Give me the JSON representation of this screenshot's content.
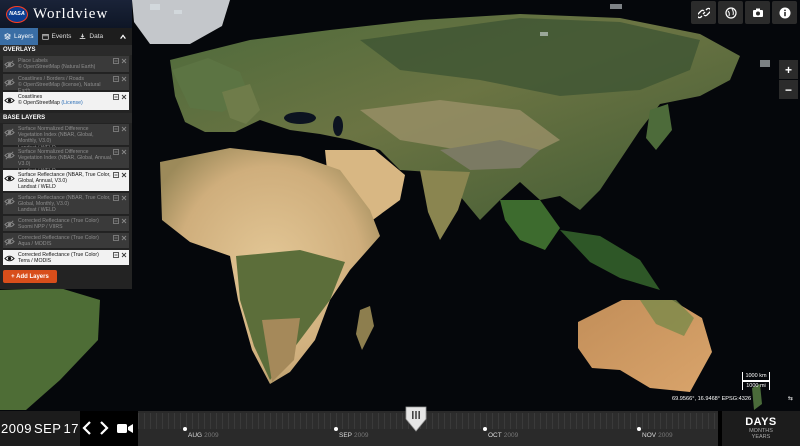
{
  "app": {
    "logo_text": "NASA",
    "title": "Worldview"
  },
  "tabs": [
    {
      "label": "Layers",
      "icon": "layers-icon",
      "active": true
    },
    {
      "label": "Events",
      "icon": "calendar-icon",
      "active": false
    },
    {
      "label": "Data",
      "icon": "download-icon",
      "active": false
    }
  ],
  "overlays": {
    "title": "OVERLAYS",
    "layers": [
      {
        "name": "Place Labels",
        "source": "© OpenStreetMap (Natural Earth)",
        "license": "",
        "visible": false
      },
      {
        "name": "Coastlines / Borders / Roads",
        "source": "© OpenStreetMap (license), Natural Earth",
        "license": "",
        "visible": false
      },
      {
        "name": "Coastlines",
        "source": "© OpenStreetMap",
        "license": "(License)",
        "visible": true
      }
    ]
  },
  "base_layers": {
    "title": "BASE LAYERS",
    "layers": [
      {
        "name": "Surface Normalized Difference Vegetation Index (NBAR, Global, Monthly, V3.0)",
        "source": "Landsat / WELD",
        "visible": false
      },
      {
        "name": "Surface Normalized Difference Vegetation Index (NBAR, Global, Annual, V3.0)",
        "source": "Landsat / WELD",
        "visible": false
      },
      {
        "name": "Surface Reflectance (NBAR, True Color, Global, Annual, V3.0)",
        "source": "Landsat / WELD",
        "visible": true
      },
      {
        "name": "Surface Reflectance (NBAR, True Color, Global, Monthly, V3.0)",
        "source": "Landsat / WELD",
        "visible": false
      },
      {
        "name": "Corrected Reflectance (True Color)",
        "source": "Suomi NPP / VIIRS",
        "visible": false
      },
      {
        "name": "Corrected Reflectance (True Color)",
        "source": "Aqua / MODIS",
        "visible": false
      },
      {
        "name": "Corrected Reflectance (True Color)",
        "source": "Terra / MODIS",
        "visible": true
      }
    ]
  },
  "add_layers_label": "+ Add Layers",
  "toolbar": [
    "link-icon",
    "globe-icon",
    "camera-icon",
    "info-icon"
  ],
  "zoom": {
    "in": "+",
    "out": "−"
  },
  "scale": {
    "km": "1000 km",
    "mi": "1000 mi"
  },
  "coordinates": "69.9566°, 16.9468° EPSG:4326",
  "date": {
    "year": "2009",
    "month": "SEP",
    "day": "17"
  },
  "timeline": {
    "months": [
      {
        "label": "AUG",
        "year": "2009"
      },
      {
        "label": "SEP",
        "year": "2009"
      },
      {
        "label": "OCT",
        "year": "2009"
      },
      {
        "label": "NOV",
        "year": "2009"
      }
    ],
    "zoom_label": "DAYS",
    "zoom_alt": "MONTHS",
    "zoom_alt2": "YEARS"
  },
  "colors": {
    "accent": "#3a6ea5",
    "add_button": "#d84e1b",
    "panel": "#262626"
  }
}
